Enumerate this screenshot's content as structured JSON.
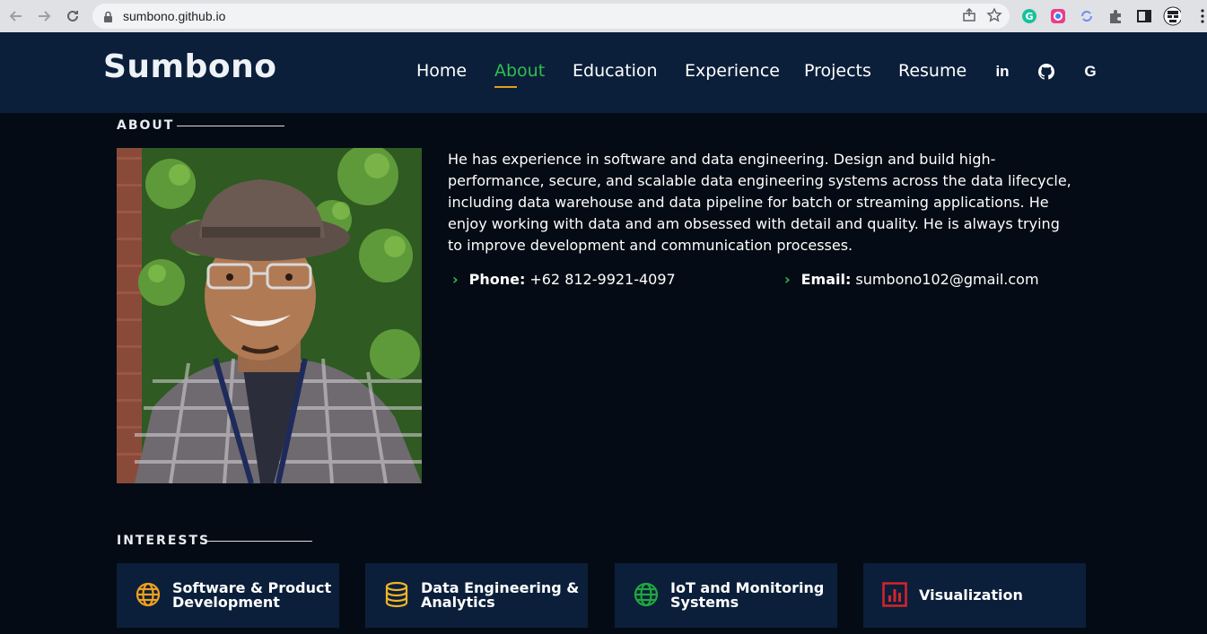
{
  "browser": {
    "url": "sumbono.github.io"
  },
  "header": {
    "logo": "Sumbono",
    "menu": [
      "Home",
      "About",
      "Education",
      "Experience",
      "Projects",
      "Resume"
    ],
    "active": "About",
    "social": {
      "linkedin": "in",
      "github_icon": "github-icon",
      "google": "G"
    },
    "colors": {
      "active": "#2fbf4f",
      "underline": "#e3a018",
      "header_bg": "#0b1f3a",
      "page_bg": "#040b14"
    }
  },
  "about": {
    "title": "ABOUT",
    "bio": "He has experience in software and data engineering. Design and build high-performance, secure, and scalable data engineering systems across the data lifecycle, including data warehouse and data pipeline for batch or streaming applications. He enjoy working with data and am obsessed with detail and quality. He is always trying to improve development and communication processes.",
    "phone_label": "Phone:",
    "phone": "+62 812-9921-4097",
    "email_label": "Email:",
    "email": "sumbono102@gmail.com"
  },
  "interests": {
    "title": "INTERESTS",
    "items": [
      {
        "label": "Software & Product Development",
        "icon": "globe-icon",
        "color": "#f0a020"
      },
      {
        "label": "Data Engineering & Analytics",
        "icon": "database-icon",
        "color": "#f0b429"
      },
      {
        "label": "IoT and Monitoring Systems",
        "icon": "globe-icon",
        "color": "#1fa83f"
      },
      {
        "label": "Visualization",
        "icon": "bar-chart-icon",
        "color": "#d6242c"
      }
    ]
  }
}
